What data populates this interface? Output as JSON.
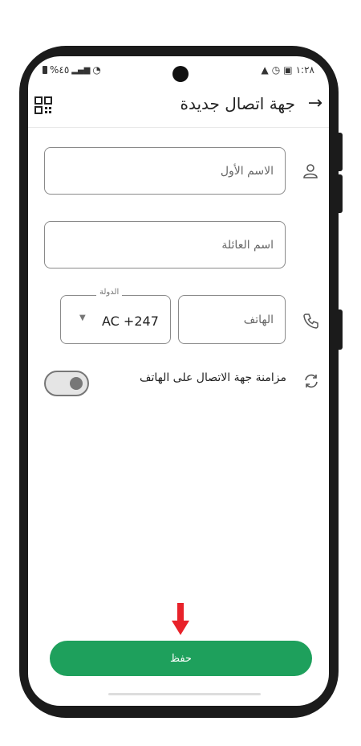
{
  "status_bar": {
    "battery": "%٤٥",
    "time": "١:٢٨"
  },
  "header": {
    "title": "جهة اتصال جديدة"
  },
  "form": {
    "first_name_placeholder": "الاسم الأول",
    "last_name_placeholder": "اسم العائلة",
    "phone_placeholder": "الهاتف",
    "country_label": "الدولة",
    "country_value": "AC +247"
  },
  "sync": {
    "label": "مزامنة جهة الاتصال على الهاتف",
    "enabled": false
  },
  "save_button": {
    "label": "حفظ"
  },
  "colors": {
    "accent": "#1ea05c",
    "arrow": "#e8222a"
  },
  "icons": [
    "back-arrow-icon",
    "qr-code-icon",
    "person-icon",
    "phone-icon",
    "sync-icon",
    "chevron-down-icon"
  ]
}
